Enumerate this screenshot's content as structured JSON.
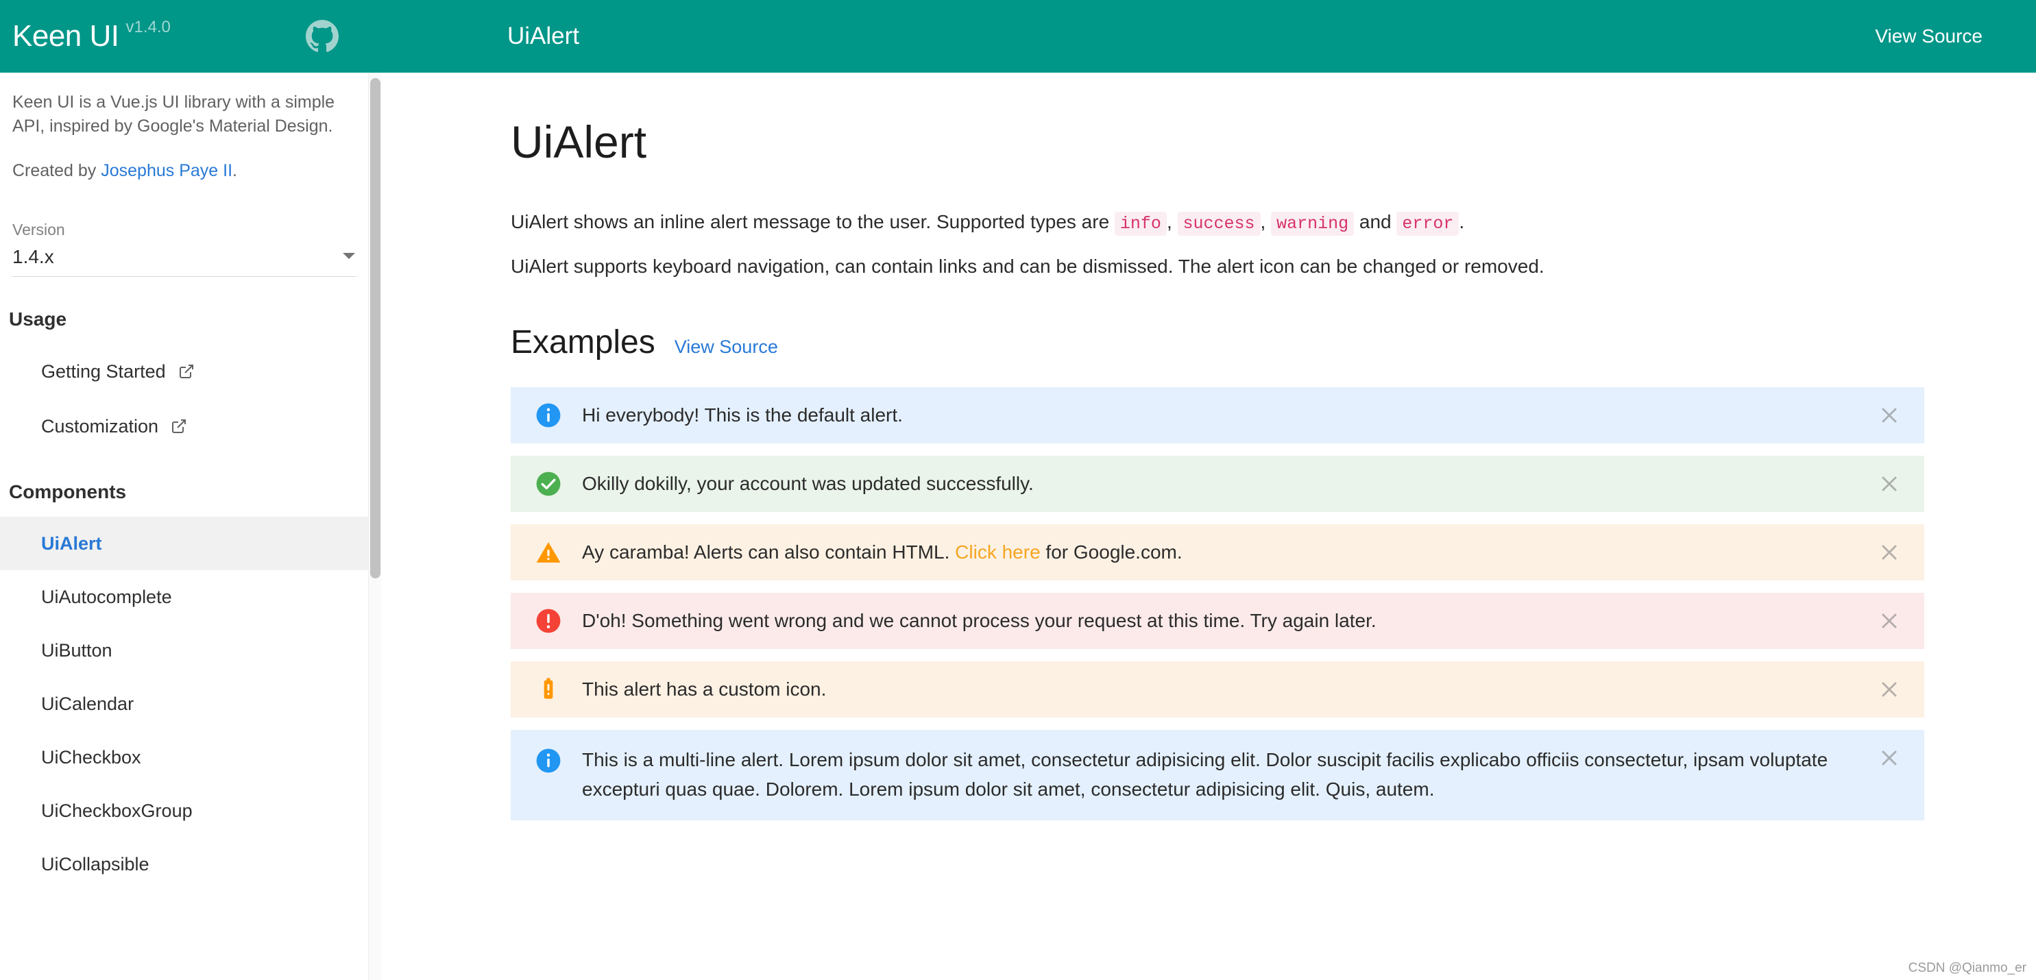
{
  "appbar": {
    "brand": "Keen UI",
    "brand_version": "v1.4.0",
    "github_icon": "github-icon",
    "page_title": "UiAlert",
    "view_source_label": "View Source",
    "background_color": "#009688"
  },
  "sidebar": {
    "description": "Keen UI is a Vue.js UI library with a simple API, inspired by Google's Material Design.",
    "created_prefix": "Created by ",
    "created_link": "Josephus Paye II",
    "created_suffix": ".",
    "version_label": "Version",
    "version_value": "1.4.x",
    "usage_heading": "Usage",
    "usage_items": [
      {
        "label": "Getting Started",
        "icon": "external-link-icon"
      },
      {
        "label": "Customization",
        "icon": "external-link-icon"
      }
    ],
    "components_heading": "Components",
    "component_items": [
      {
        "label": "UiAlert",
        "active": true
      },
      {
        "label": "UiAutocomplete",
        "active": false
      },
      {
        "label": "UiButton",
        "active": false
      },
      {
        "label": "UiCalendar",
        "active": false
      },
      {
        "label": "UiCheckbox",
        "active": false
      },
      {
        "label": "UiCheckboxGroup",
        "active": false
      },
      {
        "label": "UiCollapsible",
        "active": false
      }
    ]
  },
  "main": {
    "title": "UiAlert",
    "intro_1_a": "UiAlert shows an inline alert message to the user. Supported types are ",
    "intro_1_code_1": "info",
    "intro_1_sep_1": ", ",
    "intro_1_code_2": "success",
    "intro_1_sep_2": ", ",
    "intro_1_code_3": "warning",
    "intro_1_sep_3": " and ",
    "intro_1_code_4": "error",
    "intro_1_end": ".",
    "intro_2": "UiAlert supports keyboard navigation, can contain links and can be dismissed. The alert icon can be changed or removed.",
    "examples_title": "Examples",
    "examples_view_source": "View Source"
  },
  "alerts": [
    {
      "type": "info",
      "icon": "info-circle-icon",
      "icon_color": "#2196f3",
      "background": "#e4f0fd",
      "text": "Hi everybody! This is the default alert.",
      "close_icon": "close-icon",
      "multiline": false
    },
    {
      "type": "success",
      "icon": "check-circle-icon",
      "icon_color": "#4caf50",
      "background": "#eaf4ea",
      "text": "Okilly dokilly, your account was updated successfully.",
      "close_icon": "close-icon",
      "multiline": false
    },
    {
      "type": "warning",
      "icon": "warning-triangle-icon",
      "icon_color": "#ff9800",
      "background": "#fdf1e3",
      "text_before": "Ay caramba! Alerts can also contain HTML. ",
      "link_text": "Click here",
      "text_after": " for Google.com.",
      "close_icon": "close-icon",
      "multiline": false
    },
    {
      "type": "error",
      "icon": "error-circle-icon",
      "icon_color": "#f44336",
      "background": "#fceaea",
      "text": "D'oh! Something went wrong and we cannot process your request at this time. Try again later.",
      "close_icon": "close-icon",
      "multiline": false
    },
    {
      "type": "warning",
      "icon": "battery-alert-icon",
      "icon_color": "#ff9800",
      "background": "#fdf1e3",
      "text": "This alert has a custom icon.",
      "close_icon": "close-icon",
      "multiline": false
    },
    {
      "type": "info",
      "icon": "info-circle-icon",
      "icon_color": "#2196f3",
      "background": "#e4f0fd",
      "text": "This is a multi-line alert. Lorem ipsum dolor sit amet, consectetur adipisicing elit. Dolor suscipit facilis explicabo officiis consectetur, ipsam voluptate excepturi quas quae. Dolorem. Lorem ipsum dolor sit amet, consectetur adipisicing elit. Quis, autem.",
      "close_icon": "close-icon",
      "multiline": true
    }
  ],
  "watermark": "CSDN @Qianmo_er"
}
